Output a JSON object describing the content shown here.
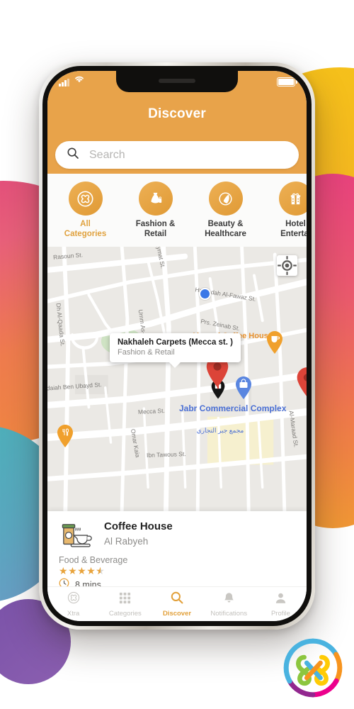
{
  "status_bar": {
    "signal_icon": "signal-bars-icon",
    "wifi_icon": "wifi-icon",
    "battery_icon": "battery-icon"
  },
  "header": {
    "title": "Discover"
  },
  "search": {
    "icon": "search-icon",
    "placeholder": "Search",
    "value": ""
  },
  "categories": [
    {
      "label": "All\nCategories",
      "line1": "All",
      "line2": "Categories",
      "icon": "xtra-logo-icon",
      "active": true
    },
    {
      "label": "Fashion & Retail",
      "line1": "Fashion &",
      "line2": "Retail",
      "icon": "dress-icon",
      "active": false
    },
    {
      "label": "Beauty & Healthcare",
      "line1": "Beauty &",
      "line2": "Healthcare",
      "icon": "leaf-drop-icon",
      "active": false
    },
    {
      "label": "Hotels & Entertainment",
      "line1": "Hotel",
      "line2": "Entertai",
      "icon": "gift-building-icon",
      "active": false
    }
  ],
  "map": {
    "locate_icon": "crosshair-locate-icon",
    "user_location_icon": "blue-dot-icon",
    "street_labels": [
      "Rasoun St.",
      "aymat St.",
      "Hamadah Al-Fawaz St.",
      "Prs. Zeinab St.",
      "Dh Al-Qaada St.",
      "Umm As-St.",
      "udaiah Ben Ubayd St.",
      "Mecca St.",
      "Omar Kaia",
      "Ibn Tawous St.",
      "Al-Maraad St."
    ],
    "pois": [
      {
        "name": "Almond Coffee House",
        "style": "orange"
      },
      {
        "name": "Jabr Commercial Complex",
        "style": "blue"
      },
      {
        "name": "مجمع جبر التجاري",
        "style": "arabic"
      }
    ],
    "callout": {
      "title": "Nakhaleh Carpets (Mecca st. )",
      "subtitle": "Fashion & Retail"
    },
    "pin_color": "#dc4438",
    "pin_dark_color": "#141414",
    "pin_blue_color": "#5a86e0",
    "pin_orange_color": "#f0a02c"
  },
  "place_card": {
    "icon": "coffee-cup-icon",
    "name": "Coffee House",
    "area": "Al Rabyeh",
    "category": "Food & Beverage",
    "rating": 4.5,
    "rating_max": 5,
    "clock_icon": "clock-icon",
    "time": "8 mins"
  },
  "tab_bar": {
    "items": [
      {
        "label": "Xtra",
        "icon": "xtra-logo-icon",
        "active": false
      },
      {
        "label": "Categories",
        "icon": "grid-icon",
        "active": false
      },
      {
        "label": "Discover",
        "icon": "search-icon",
        "active": true
      },
      {
        "label": "Notifications",
        "icon": "bell-icon",
        "active": false
      },
      {
        "label": "Profile",
        "icon": "person-icon",
        "active": false
      }
    ]
  },
  "brand_logo": {
    "name": "xtra-brand-logo",
    "colors": [
      "#4ab3e0",
      "#8cc63f",
      "#f7941e",
      "#ffcb05",
      "#ec008c",
      "#92278f"
    ]
  },
  "theme": {
    "accent": "#e8a34a",
    "accent_text": "#e2a13c",
    "map_bg": "#ebe9e5",
    "card_bg": "#ffffff"
  }
}
